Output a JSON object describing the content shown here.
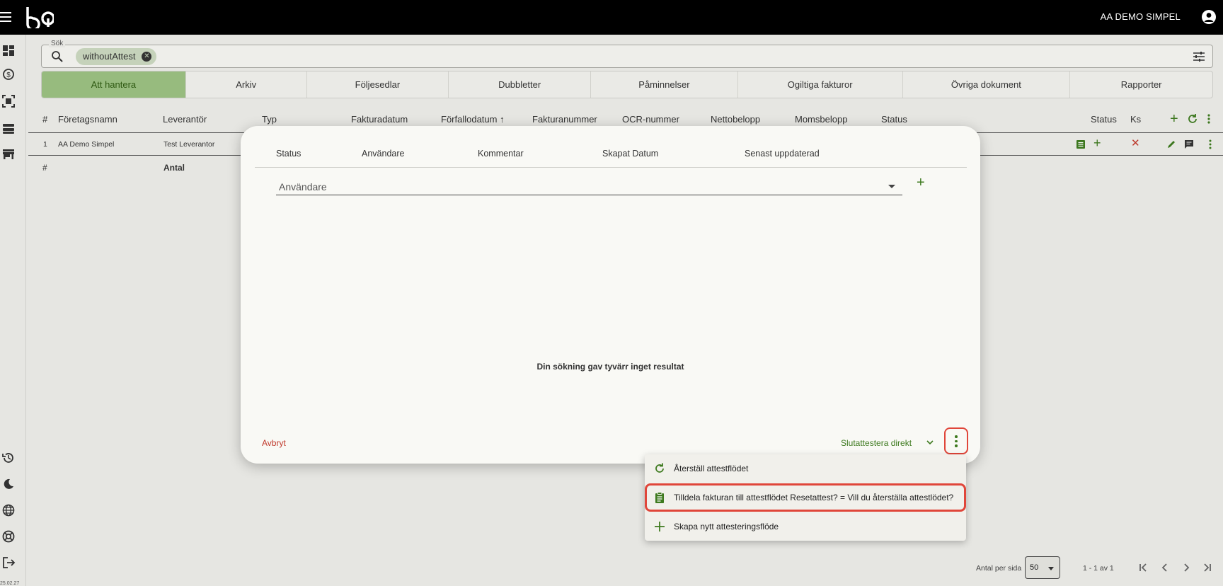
{
  "header": {
    "company": "AA DEMO SIMPEL"
  },
  "version": "25.02.27",
  "search": {
    "legend": "Sök",
    "chip": "withoutAttest"
  },
  "tabs": [
    "Att hantera",
    "Arkiv",
    "Följesedlar",
    "Dubbletter",
    "Påminnelser",
    "Ogiltiga fakturor",
    "Övriga dokument",
    "Rapporter"
  ],
  "table": {
    "headers": {
      "num": "#",
      "company": "Företagsnamn",
      "supplier": "Leverantör",
      "type": "Typ",
      "invoice_date": "Fakturadatum",
      "due_date": "Förfallodatum",
      "invoice_no": "Fakturanummer",
      "ocr": "OCR-nummer",
      "net": "Nettobelopp",
      "vat": "Momsbelopp",
      "status": "Status",
      "status2": "Status",
      "ks": "Ks"
    },
    "sort_arrow": "↑",
    "row": {
      "num": "1",
      "company": "AA Demo Simpel",
      "supplier": "Test Leverantor"
    },
    "summary": {
      "num": "#",
      "label": "Antal"
    }
  },
  "dialog": {
    "headers": [
      "Status",
      "Användare",
      "Kommentar",
      "Skapat Datum",
      "Senast uppdaterad"
    ],
    "user_placeholder": "Användare",
    "plus": "+",
    "no_result": "Din sökning gav tyvärr inget resultat",
    "cancel": "Avbryt",
    "finalize": "Slutattestera direkt"
  },
  "menu": [
    {
      "label": "Återställ attestflödet",
      "icon": "reset-icon"
    },
    {
      "label": "Tilldela fakturan till attestflödet Resetattest? = Vill du återställa attestlödet?",
      "icon": "clipboard-icon"
    },
    {
      "label": "Skapa nytt attesteringsflöde",
      "icon": "plus-icon"
    }
  ],
  "pagination": {
    "label": "Antal per sida",
    "per_page": "50",
    "range": "1 - 1 av 1"
  },
  "colors": {
    "accent": "#3e7a1f",
    "highlight": "#e0463a",
    "danger": "#c0392b"
  }
}
